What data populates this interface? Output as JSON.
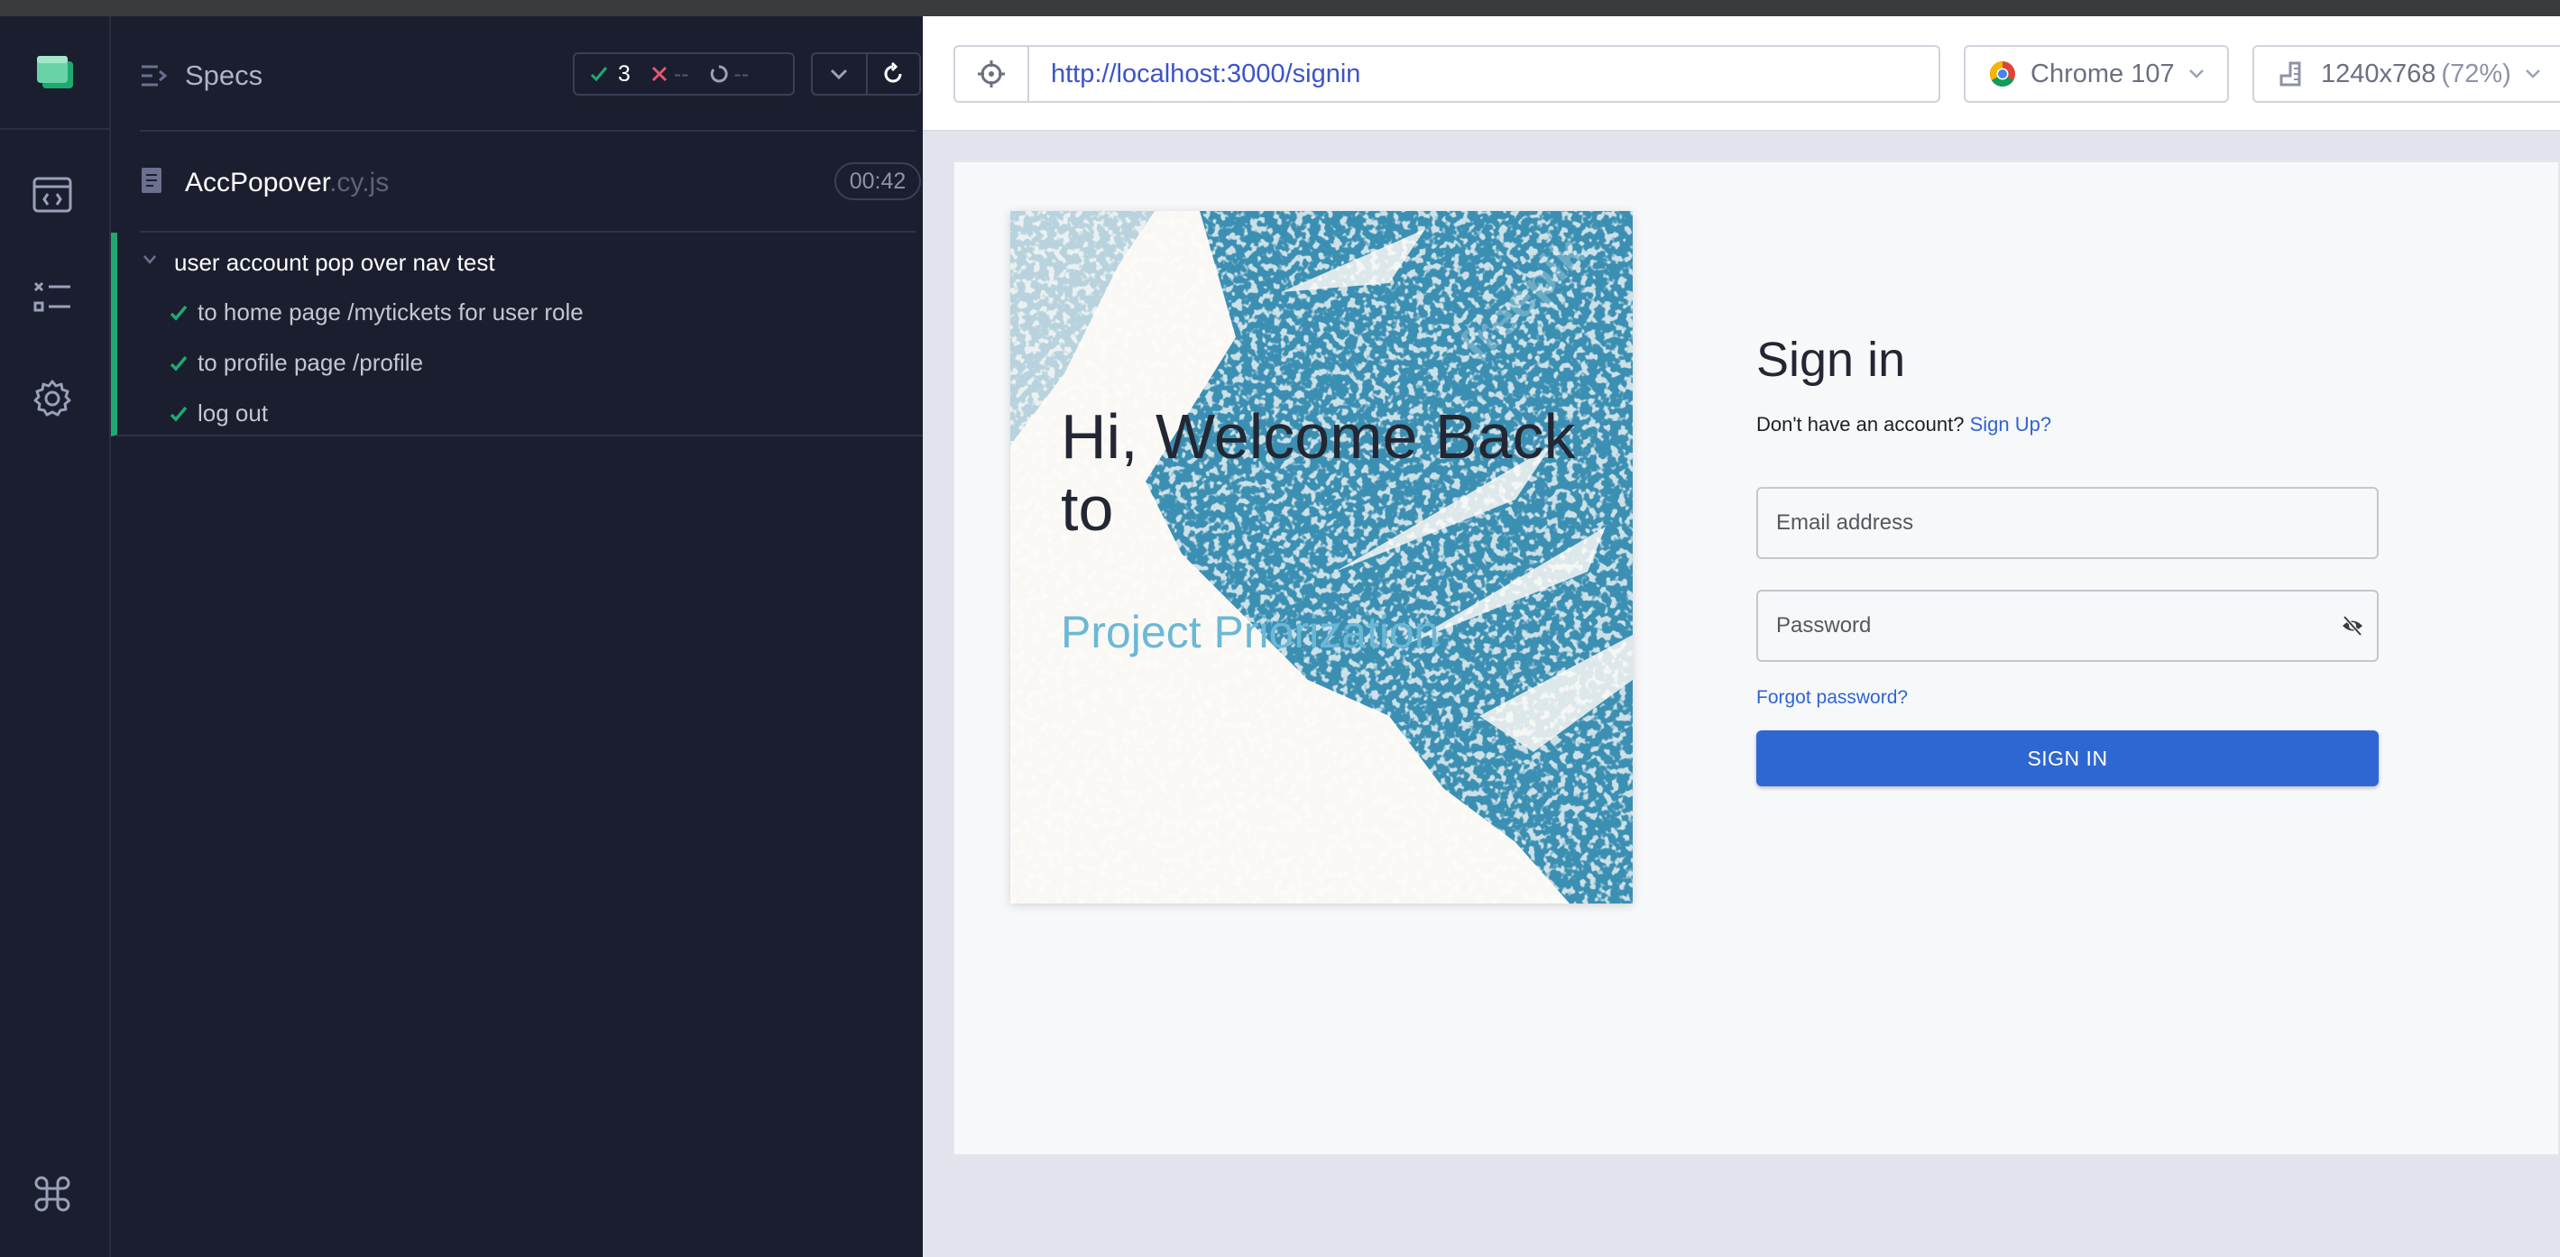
{
  "nav": {
    "items": [
      "specs-nav",
      "runs-nav",
      "settings-nav"
    ]
  },
  "specs": {
    "title": "Specs",
    "passed": "3",
    "failed": "--",
    "pending": "--"
  },
  "spec_file": {
    "name": "AccPopover",
    "ext": ".cy.js",
    "duration": "00:42"
  },
  "suite": {
    "title": "user account pop over nav test",
    "tests": [
      {
        "label": "to home page /mytickets for user role"
      },
      {
        "label": "to profile page /profile"
      },
      {
        "label": "log out"
      }
    ]
  },
  "browser_bar": {
    "url": "http://localhost:3000/signin",
    "browser": "Chrome 107",
    "viewport": "1240x768",
    "scale": "(72%)"
  },
  "app": {
    "hero_title": "Hi, Welcome Back to",
    "hero_subtitle": "Project Priorization",
    "watermark": "freepik",
    "signin_heading": "Sign in",
    "no_account_text": "Don't have an account?",
    "signup_link": "Sign Up?",
    "email_placeholder": "Email address",
    "password_placeholder": "Password",
    "forgot_link": "Forgot password?",
    "signin_button": "SIGN IN"
  },
  "colors": {
    "pass": "#1fa971",
    "fail": "#e45770",
    "link": "#2f64d0",
    "primary": "#2f67d2",
    "hero_blue": "#3b8fb2"
  }
}
